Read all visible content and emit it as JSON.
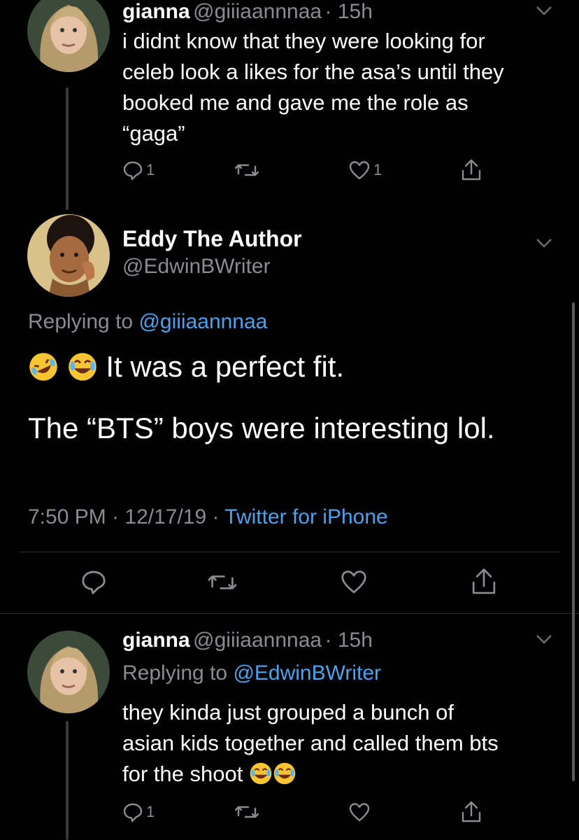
{
  "tweet1": {
    "name": "gianna",
    "handle": "@giiiaannnaa",
    "time": "· 15h",
    "lines": [
      "i didnt know that they were looking for",
      "celeb look a likes for the asa’s until they",
      "booked me and gave me the role as",
      "“gaga”"
    ],
    "reply_count": "1",
    "like_count": "1"
  },
  "main": {
    "name": "Eddy The Author",
    "handle": "@EdwinBWriter",
    "replying_prefix": "Replying to ",
    "replying_handle": "@giiiaannnaa",
    "line1": "It was a perfect fit.",
    "line2": "The “BTS” boys were interesting lol.",
    "timestamp": "7:50 PM · 12/17/19 · ",
    "source": "Twitter for iPhone"
  },
  "tweet2": {
    "name": "gianna",
    "handle": "@giiiaannnaa",
    "time": "· 15h",
    "replying_prefix": "Replying to ",
    "replying_handle": "@EdwinBWriter",
    "lines": [
      "they kinda just grouped a bunch of",
      "asian kids together and called them bts",
      "for the shoot"
    ],
    "reply_count": "1"
  },
  "icons": [
    "comment-icon",
    "retweet-icon",
    "heart-icon",
    "share-icon",
    "chevron-down-icon",
    "rofl-emoji",
    "joy-emoji"
  ],
  "colors": {
    "background": "#000000",
    "link": "#4aa3f0",
    "muted": "#8b8b90"
  }
}
